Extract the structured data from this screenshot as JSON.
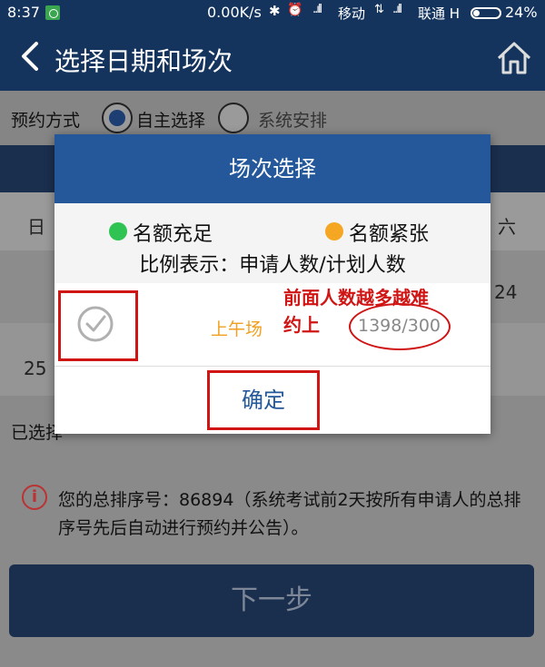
{
  "status_bar": {
    "time": "8:37",
    "speed": "0.00K/s",
    "signal1": "..ıll",
    "carrier1": "移动",
    "arrows": "⇅",
    "signal2": "..ıll",
    "carrier2": "联通 H",
    "battery": "24%"
  },
  "header": {
    "title": "选择日期和场次",
    "back_icon": "chevron-left-icon",
    "home_icon": "home-icon"
  },
  "mode": {
    "label": "预约方式",
    "options": [
      "自主选择",
      "系统安排"
    ],
    "selected": "自主选择"
  },
  "calendar": {
    "weekday_first": "日",
    "weekday_last": "六",
    "date_right": "24",
    "date_left": "25"
  },
  "selected_label": "已选择",
  "notice": {
    "text": "您的总排序号：86894（系统考试前2天按所有申请人的总排序号先后自动进行预约并公告）。"
  },
  "next_button": "下一步",
  "dialog": {
    "title": "场次选择",
    "legend_green": "名额充足",
    "legend_orange": "名额紧张",
    "ratio_desc": "比例表示：申请人数/计划人数",
    "session": {
      "name": "上午场",
      "ratio": "1398/300"
    },
    "annotation_line1": "前面人数越多越难",
    "annotation_line2": "约上",
    "confirm": "确定"
  },
  "colors": {
    "header": "#14345e",
    "dialog_title": "#24589a",
    "green": "#2ec352",
    "orange": "#f5a623",
    "annotation_red": "#d01515"
  }
}
